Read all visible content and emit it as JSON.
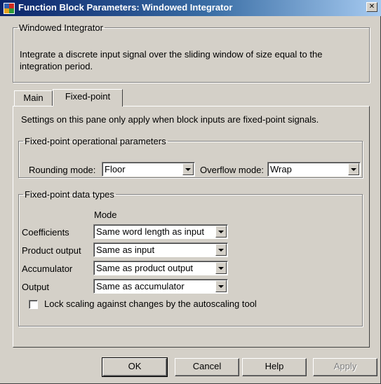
{
  "window": {
    "title": "Function Block Parameters: Windowed Integrator",
    "close_glyph": "✕",
    "icon": "simulink-block-icon"
  },
  "block": {
    "name": "Windowed Integrator",
    "description": "Integrate a discrete input signal over the sliding window of size equal to the integration period."
  },
  "tabs": [
    {
      "label": "Main",
      "active": false
    },
    {
      "label": "Fixed-point",
      "active": true
    }
  ],
  "pane": {
    "note": "Settings on this pane only apply when block inputs are fixed-point signals.",
    "op_params": {
      "legend": "Fixed-point operational parameters",
      "rounding_label": "Rounding mode:",
      "rounding_value": "Floor",
      "overflow_label": "Overflow mode:",
      "overflow_value": "Wrap"
    },
    "data_types": {
      "legend": "Fixed-point data types",
      "mode_header": "Mode",
      "rows": [
        {
          "label": "Coefficients",
          "value": "Same word length as input"
        },
        {
          "label": "Product output",
          "value": "Same as input"
        },
        {
          "label": "Accumulator",
          "value": "Same as product output"
        },
        {
          "label": "Output",
          "value": "Same as accumulator"
        }
      ],
      "lock_scaling_label": "Lock scaling against changes by the autoscaling tool",
      "lock_scaling_checked": false
    }
  },
  "buttons": {
    "ok": "OK",
    "cancel": "Cancel",
    "help": "Help",
    "apply": "Apply"
  }
}
